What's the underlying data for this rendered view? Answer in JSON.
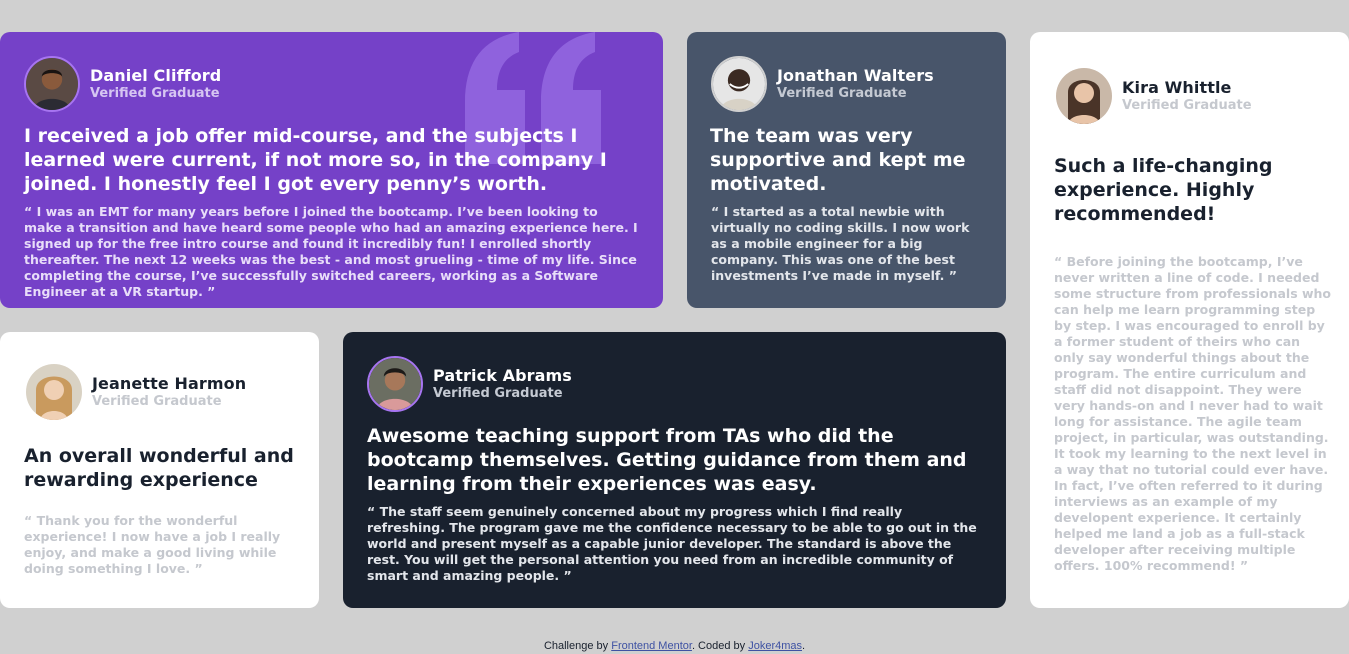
{
  "testimonials": [
    {
      "name": "Daniel Clifford",
      "role": "Verified Graduate",
      "title": "I received a job offer mid-course, and the subjects I learned were current, if not more so, in the company I joined. I honestly feel I got every penny’s worth.",
      "quote": "“ I was an EMT for many years before I joined the bootcamp. I’ve been looking to make a transition and have heard some people who had an amazing experience here. I signed up for the free intro course and found it incredibly fun! I enrolled shortly thereafter. The next 12 weeks was the best - and most grueling - time of my life. Since completing the course, I’ve successfully switched careers, working as a Software Engineer at a VR startup. ”"
    },
    {
      "name": "Jonathan Walters",
      "role": "Verified Graduate",
      "title": "The team was very supportive and kept me motivated.",
      "quote": "“ I started as a total newbie with virtually no coding skills. I now work as a mobile engineer for a big company. This was one of the best investments I’ve made in myself. ”"
    },
    {
      "name": "Kira Whittle",
      "role": "Verified Graduate",
      "title": "Such a life-changing experience. Highly recommended!",
      "quote": "“ Before joining the bootcamp, I’ve never written a line of code. I needed some structure from professionals who can help me learn programming step by step. I was encouraged to enroll by a former student of theirs who can only say wonderful things about the program. The entire curriculum and staff did not disappoint. They were very hands-on and I never had to wait long for assistance. The agile team project, in particular, was outstanding. It took my learning to the next level in a way that no tutorial could ever have. In fact, I’ve often referred to it during interviews as an example of my developent experience. It certainly helped me land a job as a full-stack developer after receiving multiple offers. 100% recommend! ”"
    },
    {
      "name": "Jeanette Harmon",
      "role": "Verified Graduate",
      "title": "An overall wonderful and rewarding experience",
      "quote": "“ Thank you for the wonderful experience! I now have a job I really enjoy, and make a good living while doing something I love. ”"
    },
    {
      "name": "Patrick Abrams",
      "role": "Verified Graduate",
      "title": "Awesome teaching support from TAs who did the bootcamp themselves. Getting guidance from them and learning from their experiences was easy.",
      "quote": "“ The staff seem genuinely concerned about my progress which I find really refreshing. The program gave me the confidence necessary to be able to go out in the world and present myself as a capable junior developer. The standard is above the rest. You will get the personal attention you need from an incredible community of smart and amazing people. ”"
    }
  ],
  "footer": {
    "prefix": "Challenge by ",
    "link1": "Frontend Mentor",
    "middle": ". Coded by ",
    "link2": "Joker4mas",
    "suffix": "."
  },
  "colors": {
    "purple": "#7541c8",
    "slate": "#48556a",
    "dark": "#19212e",
    "white": "#ffffff",
    "background": "#d0d0d0"
  }
}
